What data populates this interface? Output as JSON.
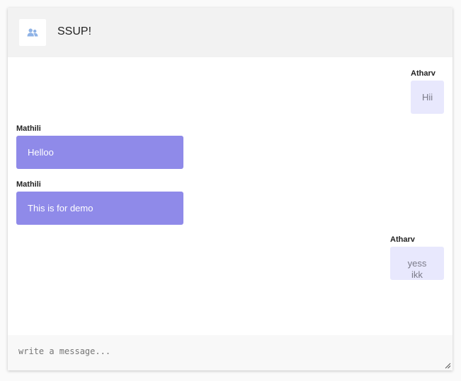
{
  "header": {
    "title": "SSUP!",
    "avatar_icon": "group-icon"
  },
  "messages": [
    {
      "sender": "Atharv",
      "text": "Hii",
      "direction": "outgoing"
    },
    {
      "sender": "Mathili",
      "text": "Helloo",
      "direction": "incoming"
    },
    {
      "sender": "Mathili",
      "text": "This is for demo",
      "direction": "incoming"
    },
    {
      "sender": "Atharv",
      "text": "yess ikk",
      "direction": "outgoing"
    }
  ],
  "composer": {
    "placeholder": "write a message...",
    "value": ""
  },
  "colors": {
    "incoming_bubble": "#8f8ae9",
    "outgoing_bubble": "#e8e8fd",
    "header_background": "#f2f2f2",
    "composer_background": "#f8f8f8",
    "icon_color": "#8fb3e6"
  }
}
